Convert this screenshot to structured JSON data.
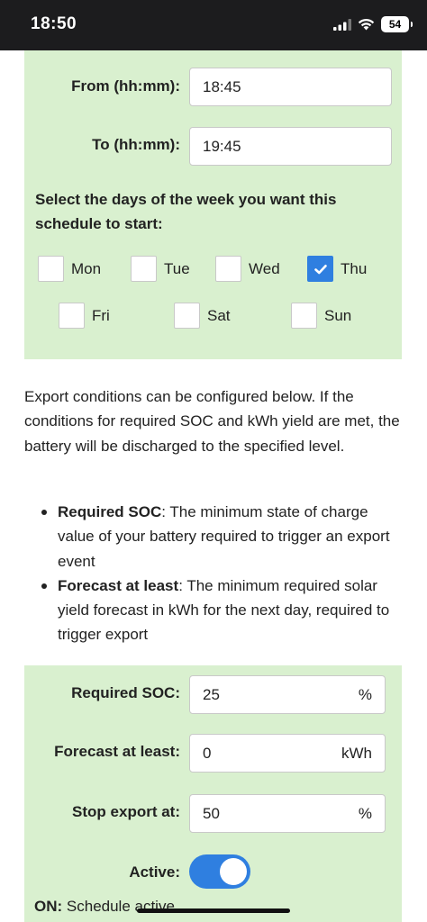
{
  "status_bar": {
    "time": "18:50",
    "battery": "54"
  },
  "schedule": {
    "from_label": "From (hh:mm):",
    "from_value": "18:45",
    "to_label": "To (hh:mm):",
    "to_value": "19:45",
    "days_title": "Select the days of the week you want this schedule to start:",
    "days": [
      {
        "label": "Mon",
        "checked": false
      },
      {
        "label": "Tue",
        "checked": false
      },
      {
        "label": "Wed",
        "checked": false
      },
      {
        "label": "Thu",
        "checked": true
      },
      {
        "label": "Fri",
        "checked": false
      },
      {
        "label": "Sat",
        "checked": false
      },
      {
        "label": "Sun",
        "checked": false
      }
    ]
  },
  "info": {
    "text": "Export conditions can be configured below. If the conditions for required SOC and kWh yield are met, the battery will be discharged to the specified level.",
    "bullets": [
      {
        "term": "Required SOC",
        "desc": ": The minimum state of charge value of your battery required to trigger an export event"
      },
      {
        "term": "Forecast at least",
        "desc": ": The minimum required solar yield forecast in kWh for the next day, required to trigger export"
      }
    ]
  },
  "export": {
    "soc_label": "Required SOC:",
    "soc_value": "25",
    "soc_unit": "%",
    "forecast_label": "Forecast at least:",
    "forecast_value": "0",
    "forecast_unit": "kWh",
    "stop_label": "Stop export at:",
    "stop_value": "50",
    "stop_unit": "%",
    "active_label": "Active:",
    "active_on": true,
    "status_prefix": "ON:",
    "status_text": " Schedule active"
  },
  "colors": {
    "panel": "#d9f0cf",
    "accent": "#2f7fe0"
  }
}
